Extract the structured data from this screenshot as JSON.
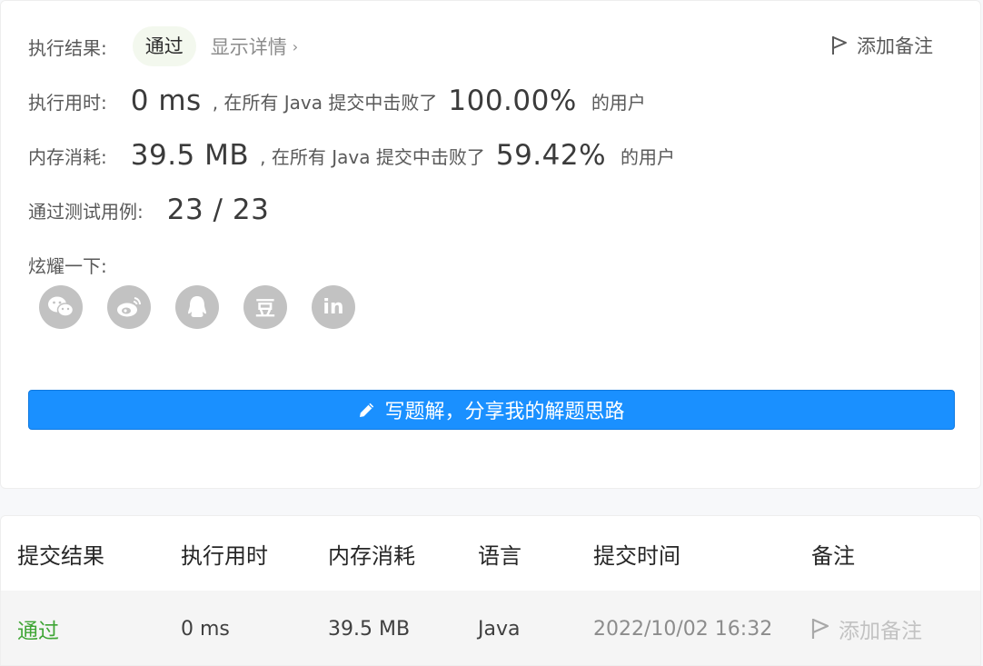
{
  "result": {
    "label": "执行结果:",
    "status": "通过",
    "details_link": "显示详情",
    "details_chevron": "›",
    "add_note": "添加备注"
  },
  "runtime": {
    "label": "执行用时:",
    "value": "0 ms",
    "mid_text": ", 在所有 Java 提交中击败了",
    "percent": "100.00%",
    "suffix": "的用户"
  },
  "memory": {
    "label": "内存消耗:",
    "value": "39.5 MB",
    "mid_text": ", 在所有 Java 提交中击败了",
    "percent": "59.42%",
    "suffix": "的用户"
  },
  "tests": {
    "label": "通过测试用例:",
    "value": "23 / 23"
  },
  "share": {
    "label": "炫耀一下:",
    "icons": [
      "wechat-icon",
      "weibo-icon",
      "qq-icon",
      "douban-icon",
      "linkedin-icon"
    ],
    "douban_glyph": "豆",
    "linkedin_glyph": "in"
  },
  "write_button": {
    "label": "写题解，分享我的解题思路",
    "icon": "pencil-icon"
  },
  "submissions": {
    "headers": [
      "提交结果",
      "执行用时",
      "内存消耗",
      "语言",
      "提交时间",
      "备注"
    ],
    "rows": [
      {
        "result": "通过",
        "runtime": "0 ms",
        "memory": "39.5 MB",
        "language": "Java",
        "time": "2022/10/02 16:32",
        "note": "添加备注"
      }
    ]
  },
  "colors": {
    "accent": "#1a90ff",
    "pass_green": "#3fa535",
    "icon_gray": "#c2c2c2"
  }
}
